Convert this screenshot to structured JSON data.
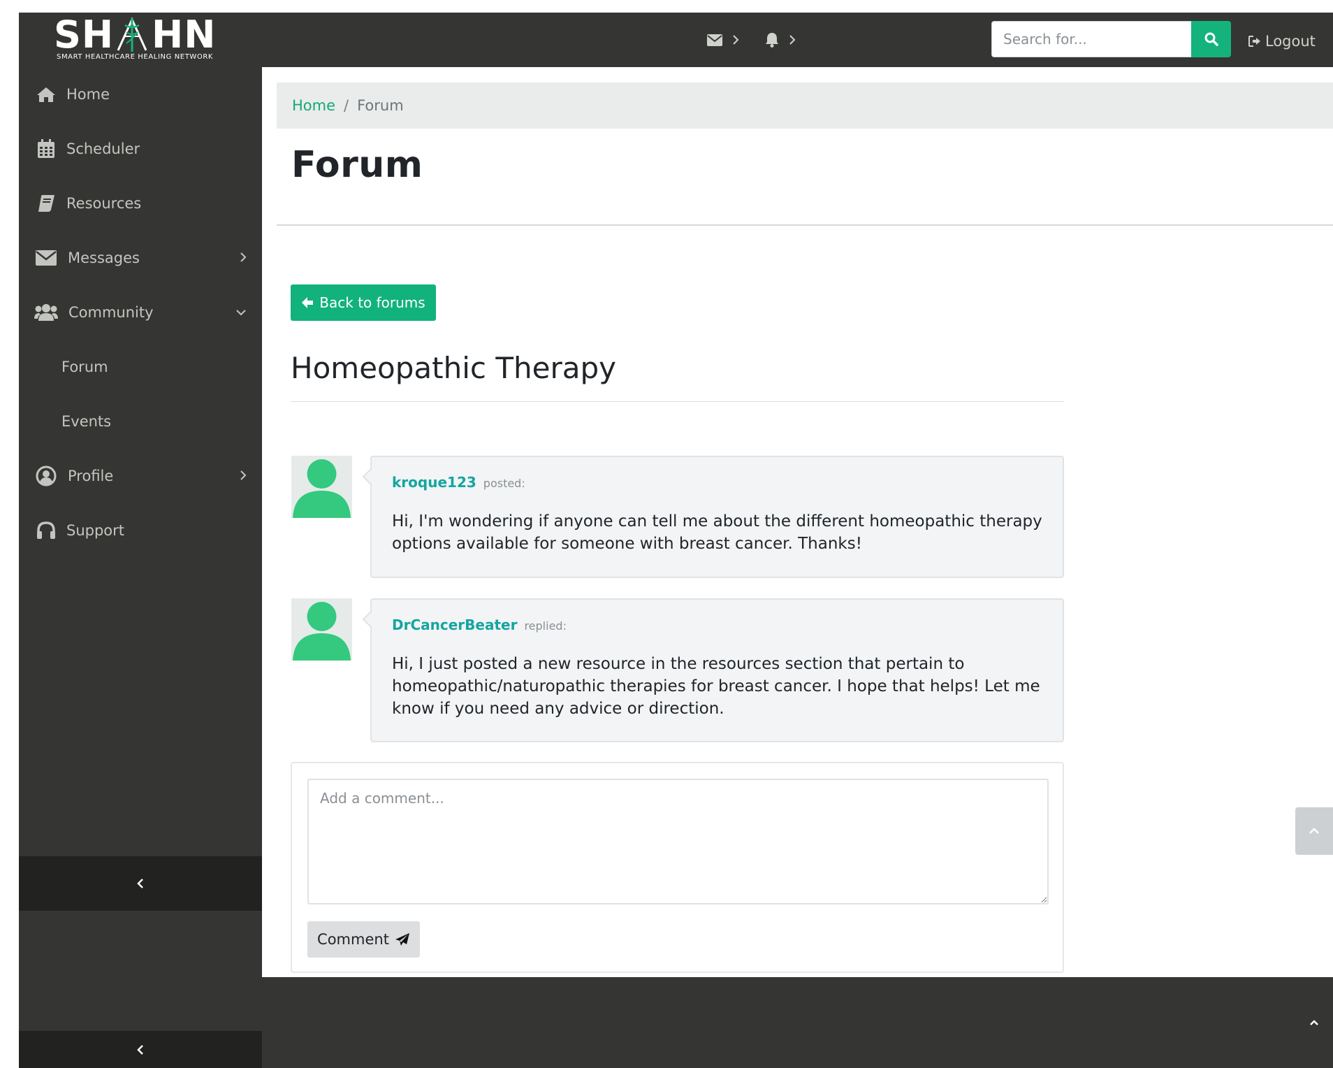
{
  "brand": {
    "name": "SHAIHN",
    "tagline": "SMART HEALTHCARE HEALING NETWORK",
    "accent_color": "#14b37d",
    "link_color": "#14a5a0",
    "dark_color": "#353633"
  },
  "header": {
    "messages_icon": "envelope-icon",
    "notifications_icon": "bell-icon",
    "search": {
      "placeholder": "Search for...",
      "value": "",
      "button_icon": "search-icon"
    },
    "logout_label": "Logout"
  },
  "sidebar": {
    "items": [
      {
        "label": "Home",
        "icon": "home-icon"
      },
      {
        "label": "Scheduler",
        "icon": "calendar-icon"
      },
      {
        "label": "Resources",
        "icon": "book-icon"
      },
      {
        "label": "Messages",
        "icon": "envelope-icon",
        "expandable": true,
        "expanded": false
      },
      {
        "label": "Community",
        "icon": "users-icon",
        "expandable": true,
        "expanded": true
      },
      {
        "label": "Profile",
        "icon": "user-circle-icon",
        "expandable": true,
        "expanded": false
      },
      {
        "label": "Support",
        "icon": "headset-icon"
      }
    ],
    "community_subitems": [
      {
        "label": "Forum"
      },
      {
        "label": "Events"
      }
    ]
  },
  "breadcrumb": {
    "home": "Home",
    "separator": "/",
    "current": "Forum"
  },
  "page": {
    "title": "Forum",
    "back_button": "Back to forums",
    "thread_title": "Homeopathic Therapy"
  },
  "posts": [
    {
      "author": "kroque123",
      "verb": "posted:",
      "body": "Hi, I'm wondering if anyone can tell me about the different homeopathic therapy options available for someone with breast cancer. Thanks!"
    },
    {
      "author": "DrCancerBeater",
      "verb": "replied:",
      "body": "Hi, I just posted a new resource in the resources section that pertain to homeopathic/naturopathic therapies for breast cancer. I hope that helps! Let me know if you need any advice or direction."
    }
  ],
  "comment": {
    "placeholder": "Add a comment...",
    "value": "",
    "button_label": "Comment",
    "button_icon": "paper-plane-icon"
  }
}
